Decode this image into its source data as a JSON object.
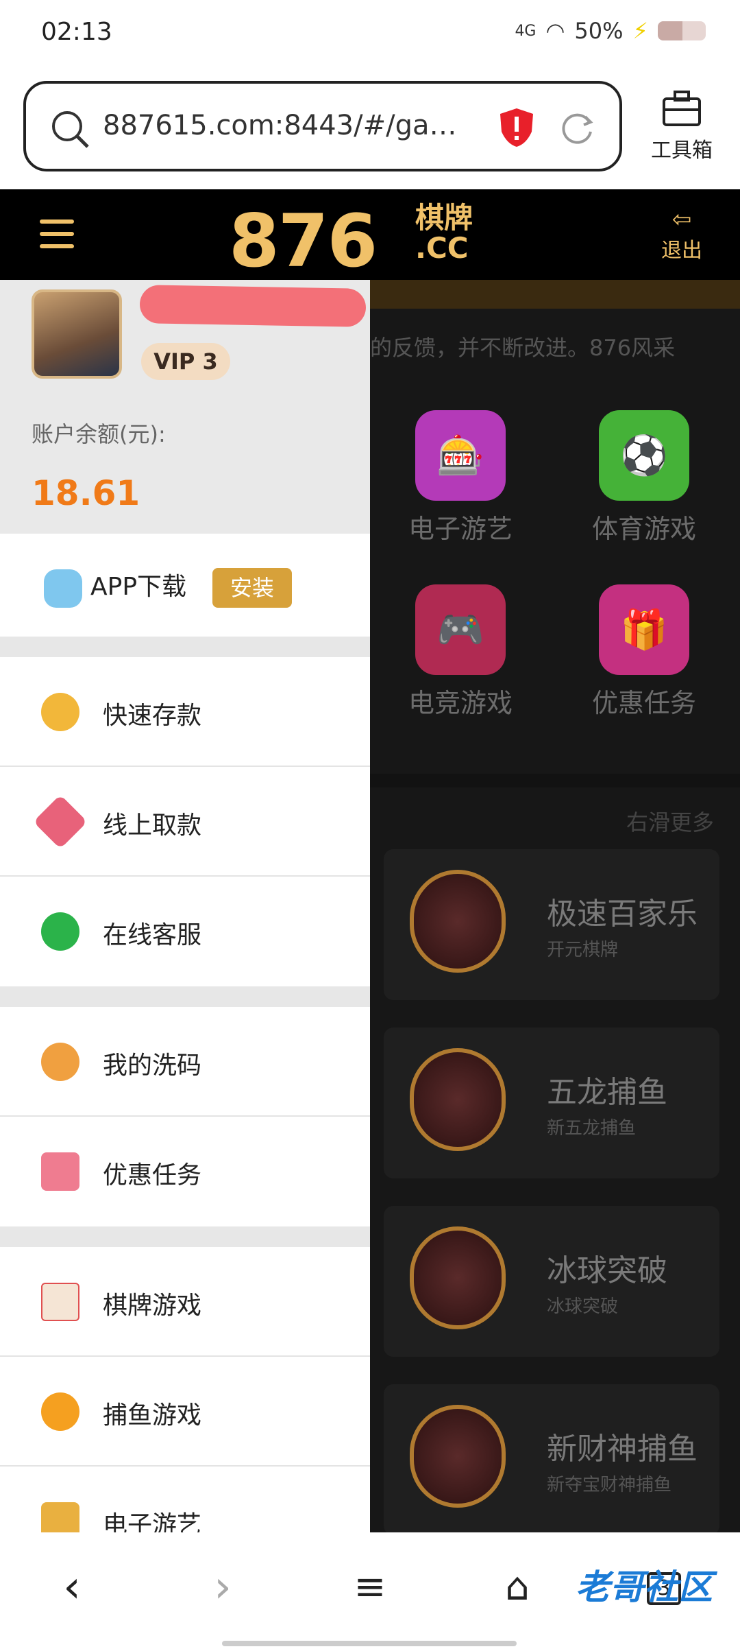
{
  "status": {
    "time": "02:13",
    "network": "4G",
    "battery": "50%"
  },
  "browser": {
    "url": "887615.com:8443/#/ga…",
    "toolbox_label": "工具箱",
    "tab_count": "3"
  },
  "header": {
    "logo_num": "876",
    "logo_cn": "棋牌",
    "logo_cc": ".CC",
    "exit_label": "退出"
  },
  "background": {
    "marquee": "的反馈，并不断改进。876风采",
    "categories": [
      {
        "label": "电子游艺",
        "icon": "slot-machine-icon",
        "color": "#c63ec4"
      },
      {
        "label": "体育游戏",
        "icon": "soccer-ball-icon",
        "color": "#4fc63e"
      },
      {
        "label": "电竞游戏",
        "icon": "gamepad-icon",
        "color": "#c62e5a"
      },
      {
        "label": "优惠任务",
        "icon": "gift-icon",
        "color": "#d83a8a"
      }
    ],
    "swipe_more": "右滑更多",
    "games": [
      {
        "title": "极速百家乐",
        "subtitle": "开元棋牌"
      },
      {
        "title": "五龙捕鱼",
        "subtitle": "新五龙捕鱼"
      },
      {
        "title": "冰球突破",
        "subtitle": "冰球突破"
      },
      {
        "title": "新财神捕鱼",
        "subtitle": "新夺宝财神捕鱼"
      }
    ]
  },
  "drawer": {
    "vip": "VIP 3",
    "balance_label": "账户余额(元):",
    "balance": "18.61",
    "app_download": "APP下载",
    "install": "安装",
    "menu": [
      {
        "label": "快速存款",
        "icon": "money-bag-icon"
      },
      {
        "label": "线上取款",
        "icon": "withdraw-icon"
      },
      {
        "label": "在线客服",
        "icon": "headset-icon"
      },
      {
        "label": "我的洗码",
        "icon": "coin-icon"
      },
      {
        "label": "优惠任务",
        "icon": "gift-icon"
      },
      {
        "label": "棋牌游戏",
        "icon": "cards-icon"
      },
      {
        "label": "捕鱼游戏",
        "icon": "fish-icon"
      },
      {
        "label": "电子游艺",
        "icon": "slot-icon"
      }
    ]
  },
  "watermark": "老哥社区"
}
